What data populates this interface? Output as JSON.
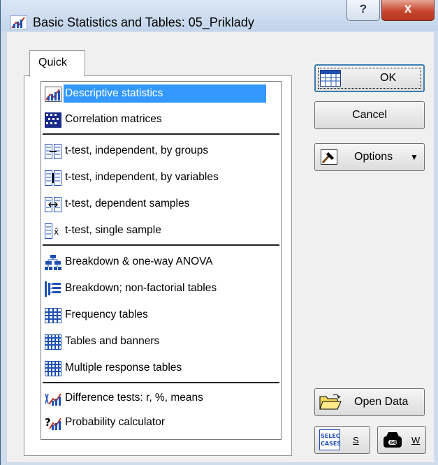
{
  "window": {
    "title": "Basic Statistics and Tables: 05_Priklady",
    "help_label": "?",
    "close_label": "x"
  },
  "tabs": [
    {
      "label": "Quick",
      "active": true
    }
  ],
  "list": {
    "items": [
      {
        "label": "Descriptive statistics",
        "icon": "descriptive-stats-icon",
        "selected": true
      },
      {
        "label": "Correlation matrices",
        "icon": "correlation-matrix-icon"
      },
      {
        "label": "t-test, independent, by groups",
        "icon": "ttest-groups-icon"
      },
      {
        "label": "t-test, independent, by variables",
        "icon": "ttest-variables-icon"
      },
      {
        "label": "t-test, dependent samples",
        "icon": "ttest-dependent-icon"
      },
      {
        "label": "t-test, single sample",
        "icon": "ttest-single-icon"
      },
      {
        "label": "Breakdown & one-way ANOVA",
        "icon": "breakdown-anova-icon"
      },
      {
        "label": "Breakdown; non-factorial tables",
        "icon": "breakdown-nonfactorial-icon"
      },
      {
        "label": "Frequency tables",
        "icon": "frequency-table-icon"
      },
      {
        "label": "Tables and banners",
        "icon": "tables-banners-icon"
      },
      {
        "label": "Multiple response tables",
        "icon": "multiple-response-icon"
      },
      {
        "label": "Difference tests: r, %, means",
        "icon": "difference-tests-icon"
      },
      {
        "label": "Probability calculator",
        "icon": "probability-calculator-icon"
      }
    ]
  },
  "buttons": {
    "ok": "OK",
    "cancel": "Cancel",
    "options": "Options",
    "open_data": "Open Data",
    "select_cases_icon_text": "SELECT CASES",
    "select_cases_short": "S",
    "weight_short": "W"
  },
  "colors": {
    "selection": "#3399ff",
    "close_button": "#c6452d"
  }
}
